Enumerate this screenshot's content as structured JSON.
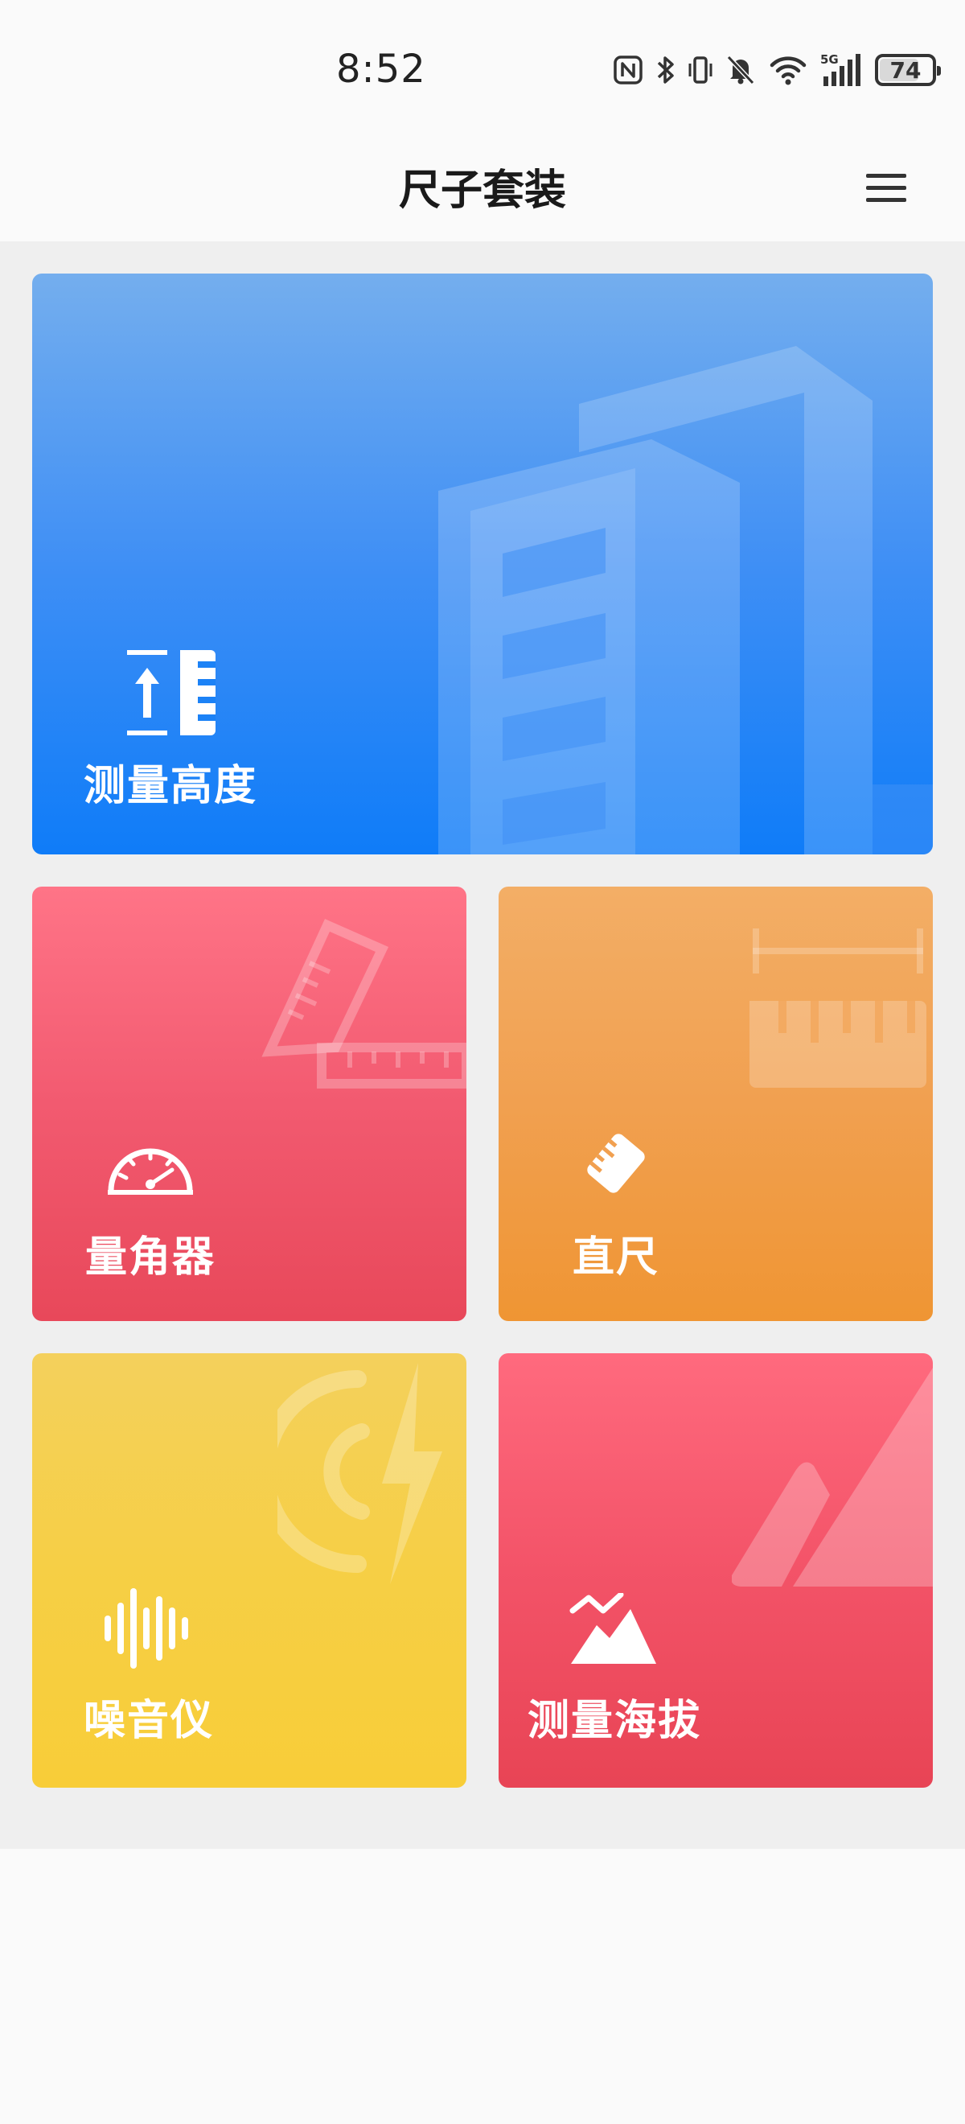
{
  "status_bar": {
    "time": "8:52",
    "battery_level": "74",
    "icons": [
      "nfc-icon",
      "bluetooth-icon",
      "vibrate-icon",
      "mute-icon",
      "wifi-icon",
      "signal-5g-icon",
      "battery-icon"
    ]
  },
  "app_bar": {
    "title": "尺子套装",
    "menu_icon": "hamburger-menu-icon"
  },
  "cards": {
    "height": {
      "label": "测量高度",
      "icon": "measure-height-icon",
      "color": "#1a7ff6"
    },
    "protractor": {
      "label": "量角器",
      "icon": "gauge-icon",
      "color": "#f0566b"
    },
    "ruler": {
      "label": "直尺",
      "icon": "ruler-icon",
      "color": "#f1a050"
    },
    "noise": {
      "label": "噪音仪",
      "icon": "sound-wave-icon",
      "color": "#f6cf45"
    },
    "altitude": {
      "label": "测量海拔",
      "icon": "mountain-chart-icon",
      "color": "#f04d62"
    }
  }
}
